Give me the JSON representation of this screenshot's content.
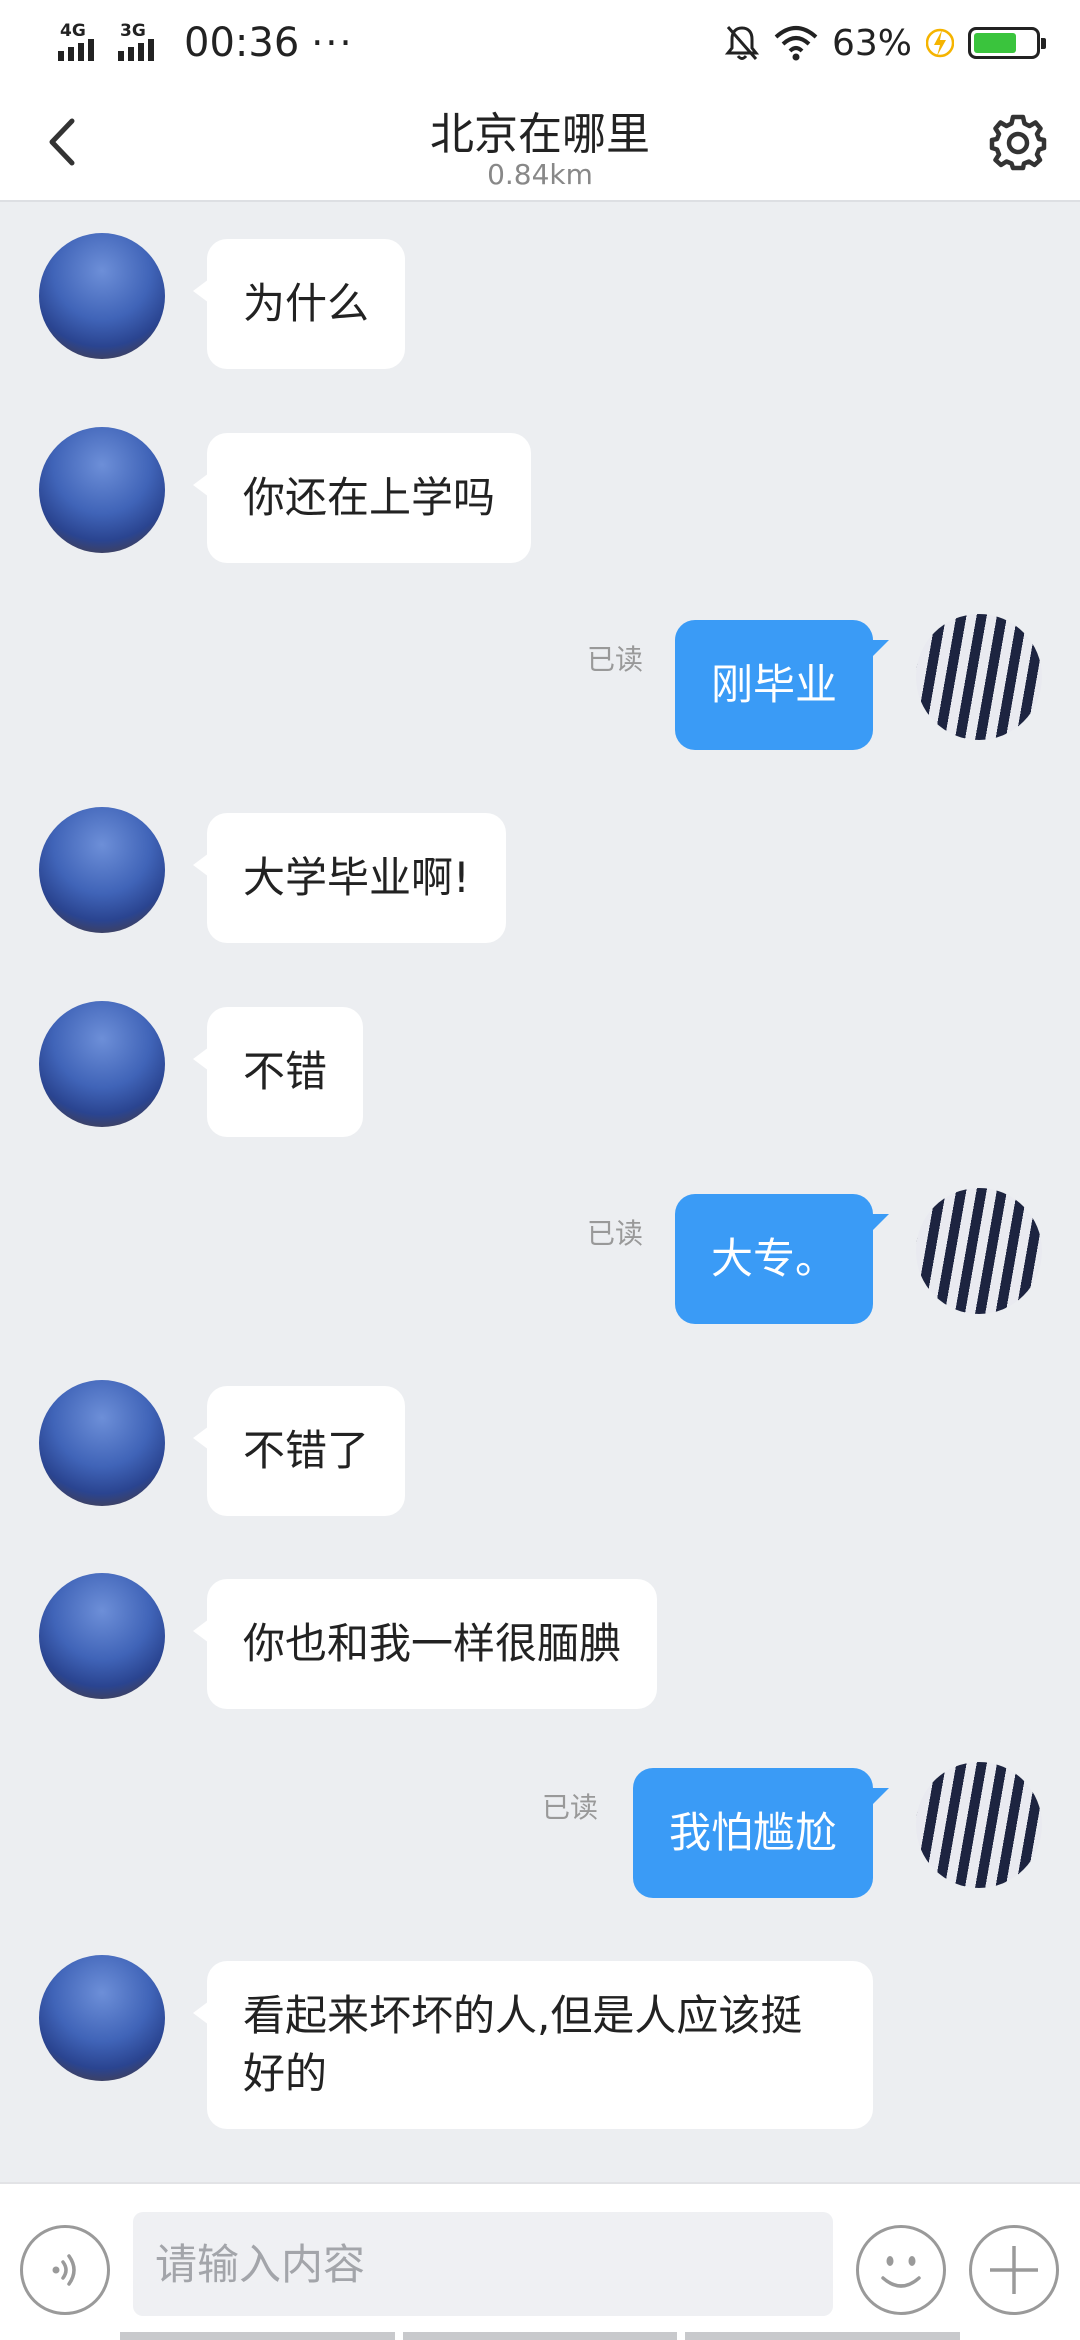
{
  "status_bar": {
    "network_1": "4G",
    "network_2": "3G",
    "time": "00:36",
    "more": "···",
    "battery_percent": "63%",
    "battery_level": 0.63,
    "icons": [
      "signal-icon",
      "mute-icon",
      "wifi-icon",
      "charging-icon",
      "battery-icon"
    ]
  },
  "header": {
    "title": "北京在哪里",
    "distance": "0.84km",
    "icons": [
      "back-icon",
      "settings-icon"
    ]
  },
  "messages": [
    {
      "side": "in",
      "text": "为什么"
    },
    {
      "side": "in",
      "text": "你还在上学吗"
    },
    {
      "side": "out",
      "text": "刚毕业",
      "read": "已读"
    },
    {
      "side": "in",
      "text": "大学毕业啊!"
    },
    {
      "side": "in",
      "text": "不错"
    },
    {
      "side": "out",
      "text": "大专。",
      "read": "已读"
    },
    {
      "side": "in",
      "text": "不错了"
    },
    {
      "side": "in",
      "text": "你也和我一样很腼腆"
    },
    {
      "side": "out",
      "text": "我怕尴尬",
      "read": "已读"
    },
    {
      "side": "in",
      "text": "看起来坏坏的人,但是人应该挺好的"
    }
  ],
  "input_bar": {
    "placeholder": "请输入内容",
    "icons": [
      "voice-icon",
      "emoji-icon",
      "plus-icon"
    ]
  },
  "colors": {
    "accent": "#3a9bf6",
    "chat_background": "#eceef1",
    "battery": "#3ac43d",
    "charging": "#f5b400"
  }
}
